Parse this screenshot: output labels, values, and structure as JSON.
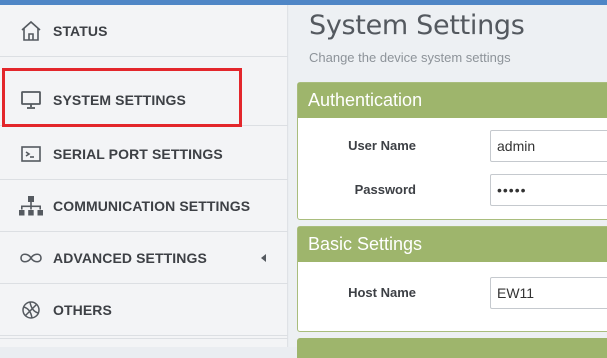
{
  "sidebar": {
    "items": [
      {
        "label": "STATUS",
        "icon": "home-icon"
      },
      {
        "label": "SYSTEM SETTINGS",
        "icon": "monitor-icon"
      },
      {
        "label": "SERIAL PORT SETTINGS",
        "icon": "terminal-icon"
      },
      {
        "label": "COMMUNICATION SETTINGS",
        "icon": "network-icon"
      },
      {
        "label": "ADVANCED SETTINGS",
        "icon": "infinity-icon"
      },
      {
        "label": "OTHERS",
        "icon": "basketball-icon"
      }
    ]
  },
  "main": {
    "title": "System Settings",
    "subtitle": "Change the device system settings",
    "authentication": {
      "header": "Authentication",
      "username_label": "User Name",
      "username_value": "admin",
      "password_label": "Password",
      "password_value": "•••••"
    },
    "basic": {
      "header": "Basic Settings",
      "hostname_label": "Host Name",
      "hostname_value": "EW11"
    }
  },
  "colors": {
    "panel_header": "#9eb56c",
    "highlight": "#e3262b",
    "topbar": "#4f86c6"
  }
}
